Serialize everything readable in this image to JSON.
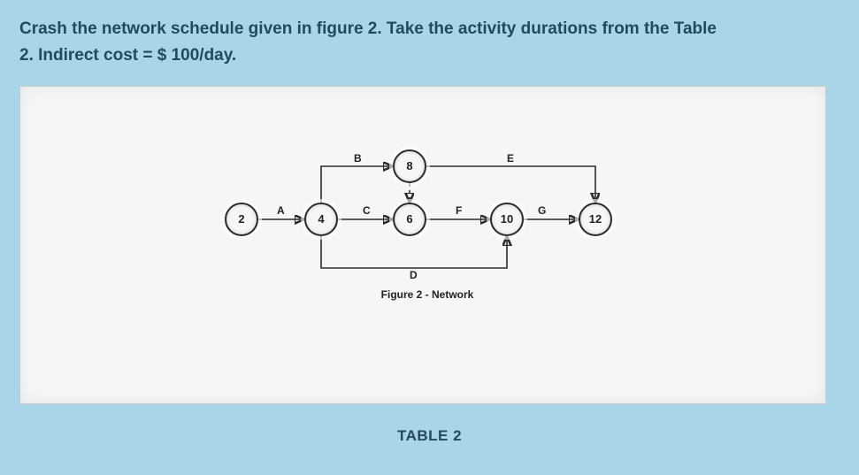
{
  "question": {
    "line1": "Crash the network schedule given in figure 2. Take the activity durations from the Table",
    "line2": "2. Indirect cost = $ 100/day."
  },
  "figure": {
    "caption": "Figure 2 - Network",
    "nodes": {
      "n2": "2",
      "n4": "4",
      "n6": "6",
      "n8": "8",
      "n10": "10",
      "n12": "12"
    },
    "edges": {
      "A": "A",
      "B": "B",
      "C": "C",
      "D": "D",
      "E": "E",
      "F": "F",
      "G": "G"
    }
  },
  "table": {
    "label": "TABLE 2"
  },
  "chart_data": {
    "type": "table",
    "description": "Activity-on-arrow project network",
    "nodes": [
      2,
      4,
      6,
      8,
      10,
      12
    ],
    "activities": [
      {
        "name": "A",
        "from": 2,
        "to": 4
      },
      {
        "name": "B",
        "from": 4,
        "to": 8
      },
      {
        "name": "C",
        "from": 4,
        "to": 6
      },
      {
        "name": "D",
        "from": 4,
        "to": 10
      },
      {
        "name": "dummy",
        "from": 8,
        "to": 6,
        "dashed": true
      },
      {
        "name": "E",
        "from": 8,
        "to": 12
      },
      {
        "name": "F",
        "from": 6,
        "to": 10
      },
      {
        "name": "G",
        "from": 10,
        "to": 12
      }
    ],
    "indirect_cost_per_day": 100
  }
}
